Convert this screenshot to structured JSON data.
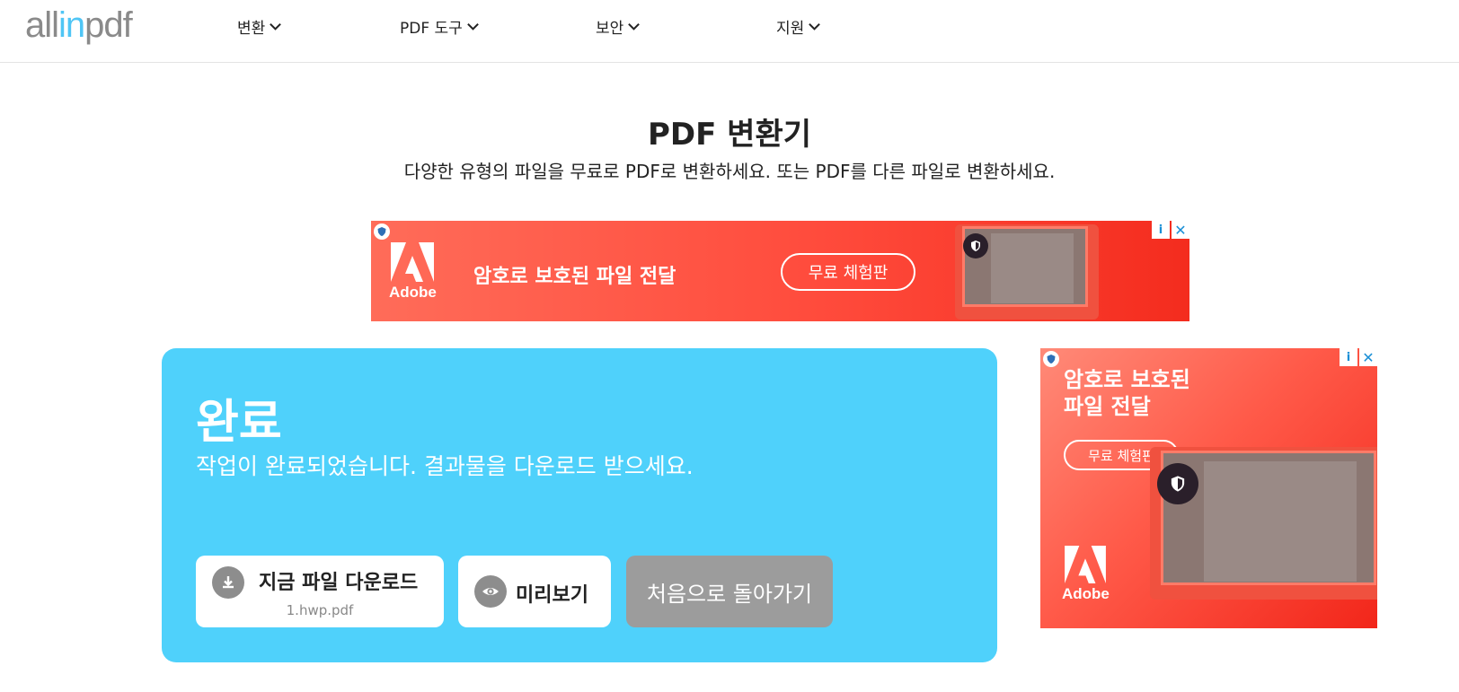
{
  "header": {
    "logo": {
      "part1": "all",
      "part2": "in",
      "part3": "pdf"
    },
    "nav": [
      {
        "label": "변환"
      },
      {
        "label": "PDF 도구"
      },
      {
        "label": "보안"
      },
      {
        "label": "지원"
      }
    ]
  },
  "hero": {
    "title": "PDF 변환기",
    "subtitle": "다양한 유형의 파일을 무료로 PDF로 변환하세요. 또는 PDF를 다른 파일로 변환하세요."
  },
  "ad_banner": {
    "brand": "Adobe",
    "headline": "암호로 보호된 파일 전달",
    "cta": "무료 체험판",
    "info_icon": "i",
    "close_icon": "✕"
  },
  "result_card": {
    "title": "완료",
    "message": "작업이 완료되었습니다. 결과물을 다운로드 받으세요.",
    "download_label": "지금 파일 다운로드",
    "file_name": "1.hwp.pdf",
    "preview_label": "미리보기",
    "back_label": "처음으로 돌아가기"
  },
  "ad_side": {
    "headline_line1": "암호로 보호된",
    "headline_line2": "파일 전달",
    "cta": "무료 체험판",
    "brand": "Adobe",
    "info_icon": "i",
    "close_icon": "✕"
  },
  "colors": {
    "accent": "#4fd1fb",
    "logo_accent": "#4fc5f5",
    "ad_red": "#f42c1e",
    "button_gray": "#9c9c9c"
  }
}
